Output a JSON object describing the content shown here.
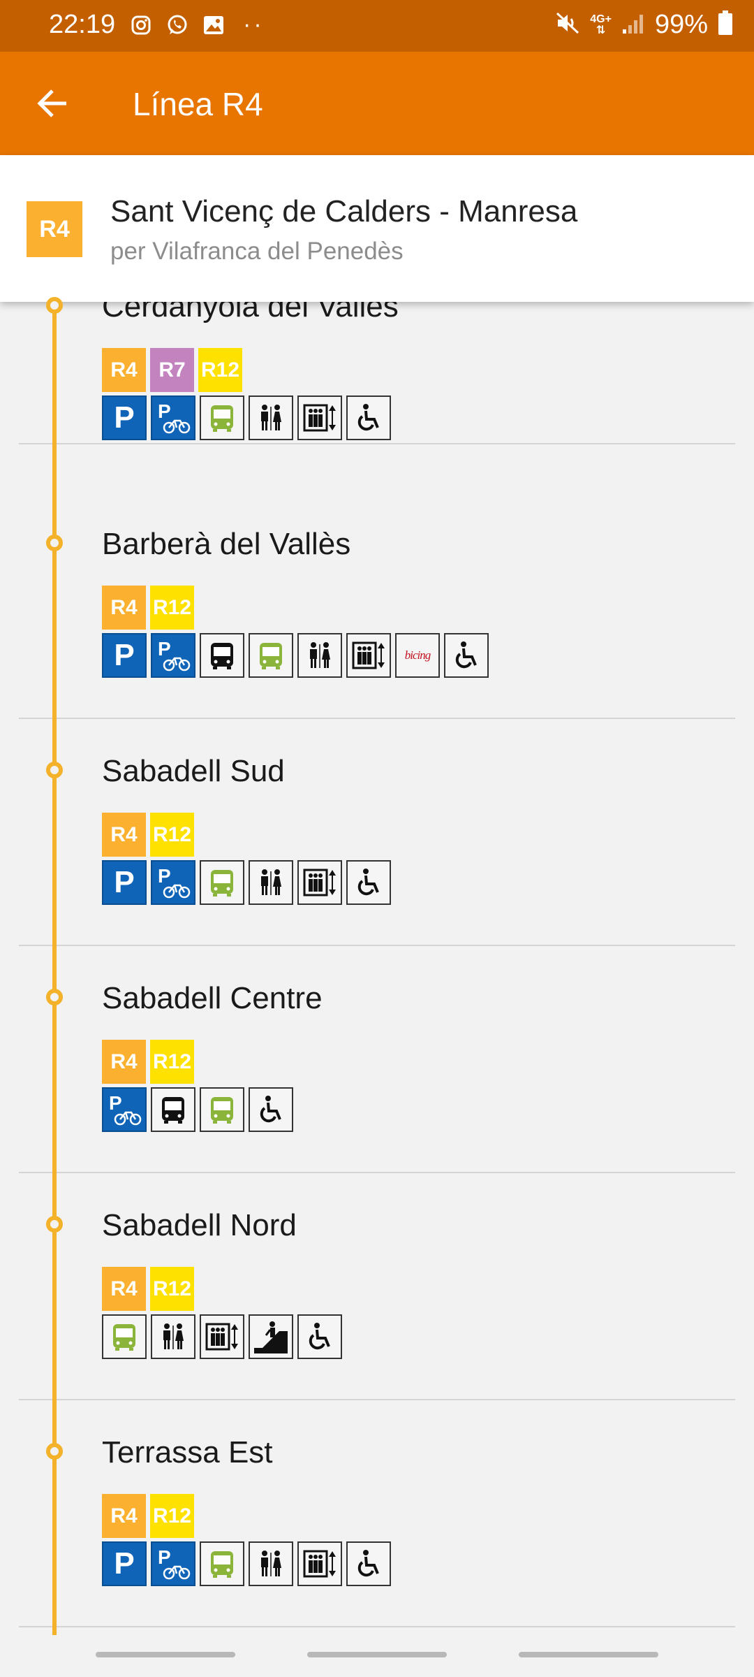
{
  "status_bar": {
    "time": "22:19",
    "left_icons": [
      "instagram-icon",
      "whatsapp-icon",
      "gallery-icon"
    ],
    "more": "··",
    "network": "4G+",
    "battery": "99%"
  },
  "app_bar": {
    "back_icon": "back-arrow-icon",
    "title": "Línea R4"
  },
  "line_header": {
    "badge": "R4",
    "badge_color": "#fbb12f",
    "route": "Sant Vicenç de Calders - Manresa",
    "via": "per Vilafranca del Penedès"
  },
  "colors": {
    "R4": "#fbb12f",
    "R7": "#c283bf",
    "R12": "#ffe100",
    "accent": "#e87500",
    "status": "#c45f00"
  },
  "stops": [
    {
      "name": "Cerdanyola del Vallès",
      "lines": [
        "R4",
        "R7",
        "R12"
      ],
      "services": [
        "parking",
        "bike-parking",
        "intercity-bus",
        "toilets",
        "elevator",
        "accessible"
      ]
    },
    {
      "name": "Barberà del Vallès",
      "lines": [
        "R4",
        "R12"
      ],
      "services": [
        "parking",
        "bike-parking",
        "urban-bus",
        "intercity-bus",
        "toilets",
        "elevator",
        "bicing",
        "accessible"
      ]
    },
    {
      "name": "Sabadell Sud",
      "lines": [
        "R4",
        "R12"
      ],
      "services": [
        "parking",
        "bike-parking",
        "intercity-bus",
        "toilets",
        "elevator",
        "accessible"
      ]
    },
    {
      "name": "Sabadell Centre",
      "lines": [
        "R4",
        "R12"
      ],
      "services": [
        "bike-parking",
        "urban-bus",
        "intercity-bus",
        "accessible"
      ]
    },
    {
      "name": "Sabadell Nord",
      "lines": [
        "R4",
        "R12"
      ],
      "services": [
        "intercity-bus",
        "toilets",
        "elevator",
        "escalator",
        "accessible"
      ]
    },
    {
      "name": "Terrassa Est",
      "lines": [
        "R4",
        "R12"
      ],
      "services": [
        "parking",
        "bike-parking",
        "intercity-bus",
        "toilets",
        "elevator",
        "accessible"
      ]
    }
  ],
  "bicing_label": "bicing",
  "parking_label": "P"
}
